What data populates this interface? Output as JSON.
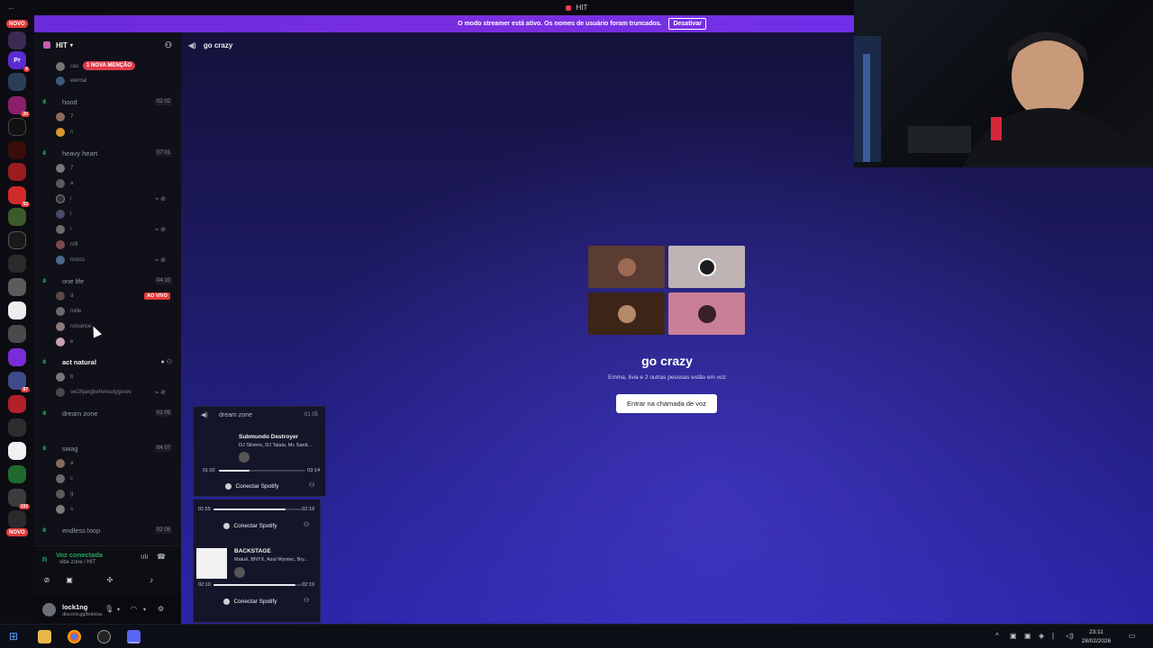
{
  "window": {
    "title": "HIT"
  },
  "banner": {
    "message": "O modo streamer está ativo. Os nomes de usuário foram truncados.",
    "button": "Desativar"
  },
  "rail": {
    "novo_top": "NOVO",
    "novo_bottom": "NOVO",
    "server_pr": "Pr"
  },
  "server": {
    "name": "HIT"
  },
  "mention": "1 NOVA MENÇÃO",
  "live_badge": "AO VIVO",
  "channels": [
    {
      "name": "hood",
      "count": "02 02"
    },
    {
      "name": "heavy heart",
      "count": "07 01"
    },
    {
      "name": "one life",
      "count": "04 10"
    },
    {
      "name": "act natural",
      "count": ""
    },
    {
      "name": "dream zone",
      "count": "01 05"
    },
    {
      "name": "swag",
      "count": "04 07"
    },
    {
      "name": "endless loop",
      "count": "02 05"
    }
  ],
  "members": {
    "top1": "cas",
    "top2": "eternal",
    "hood1": "7",
    "hood2": "n",
    "hh1": "7",
    "hh2": "a",
    "hh3": "i",
    "hh4": "i",
    "hh5": "i",
    "hh6": "rofl",
    "hh7": "toxico",
    "ol1": "d",
    "ol2": "mille",
    "ol3": "romance",
    "ol4": "e",
    "an1": "b",
    "an2": "sw2hjaxgbehvxeutygxvev",
    "sw1": "a",
    "sw2": "c",
    "sw3": "g",
    "sw4": "s"
  },
  "voice": {
    "status": "Voz conectada",
    "location": "vibe zone / HIT"
  },
  "user": {
    "name": "lock1ng",
    "status": "discord.gg/bolotas"
  },
  "stage": {
    "channel": "go crazy",
    "title": "go crazy",
    "subtitle": "Emma, livia e 2 outras pessoas estão em voz",
    "join": "Entrar na chamada de voz"
  },
  "popup": {
    "channel": "dream zone",
    "count": "01 05",
    "track1": {
      "title": "Submundo Destroyer",
      "artist": "DJ Silvério, DJ Talala, Mc Santt...",
      "elapsed": "01:02",
      "total": "03:14",
      "progress": 0.35
    },
    "connect": "Conectar Spotify",
    "track2": {
      "elapsed": "01:55",
      "total": "02:19",
      "progress": 0.82
    },
    "track3": {
      "title": "BACKSTAGE",
      "artist": "Matuê, BNYX, Azul Wyntec, Bry...",
      "elapsed": "02:10",
      "total": "02:19",
      "progress": 0.93
    }
  },
  "clock": {
    "time": "23:11",
    "date": "28/02/2026"
  },
  "colors": {
    "accent": "#5865f2",
    "banner": "#7b2fe0",
    "voice_green": "#23a55a",
    "live_red": "#e23b3b"
  }
}
